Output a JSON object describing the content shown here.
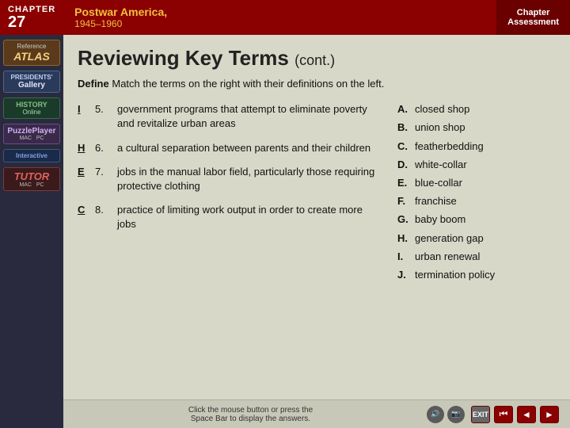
{
  "header": {
    "chapter_label": "CHAPTER",
    "chapter_number": "27",
    "book_title": "Postwar America,",
    "book_subtitle": "1945–1960",
    "nav_label": "Chapter\nAssessment"
  },
  "sidebar": {
    "items": [
      {
        "id": "atlas",
        "top": "Reference",
        "main": "ATLAS"
      },
      {
        "id": "presidents",
        "top": "PRESIDENTS'",
        "main": "Gallery"
      },
      {
        "id": "history",
        "top": "HISTORY",
        "main": "Online"
      },
      {
        "id": "puzzle",
        "top": "PuzzlePlayer",
        "sub": "MAC    PC"
      },
      {
        "id": "interactive",
        "top": "Interactive",
        "main": "TUTOR",
        "sub": "MAC    PC"
      }
    ]
  },
  "page": {
    "title": "Reviewing Key Terms",
    "cont_label": "(cont.)",
    "instructions_bold": "Define",
    "instructions_text": "Match the terms on the right with their definitions on the left.",
    "questions": [
      {
        "letter": "I",
        "number": "5.",
        "text": "government programs that attempt to eliminate poverty and revitalize urban areas"
      },
      {
        "letter": "H",
        "number": "6.",
        "text": "a cultural separation between parents and their children"
      },
      {
        "letter": "E",
        "number": "7.",
        "text": "jobs in the manual labor field, particularly those requiring protective clothing"
      },
      {
        "letter": "C",
        "number": "8.",
        "text": "practice of limiting work output in order to create more jobs"
      }
    ],
    "answers": [
      {
        "letter": "A.",
        "text": "closed shop"
      },
      {
        "letter": "B.",
        "text": "union shop"
      },
      {
        "letter": "C.",
        "text": "featherbedding"
      },
      {
        "letter": "D.",
        "text": "white-collar"
      },
      {
        "letter": "E.",
        "text": "blue-collar"
      },
      {
        "letter": "F.",
        "text": "franchise"
      },
      {
        "letter": "G.",
        "text": "baby boom"
      },
      {
        "letter": "H.",
        "text": "generation gap"
      },
      {
        "letter": "I.",
        "text": "urban renewal"
      },
      {
        "letter": "J.",
        "text": "termination policy"
      }
    ],
    "bottom_instruction": "Click the mouse button or press the\nSpace Bar to display the answers.",
    "exit_label": "EXIT"
  }
}
